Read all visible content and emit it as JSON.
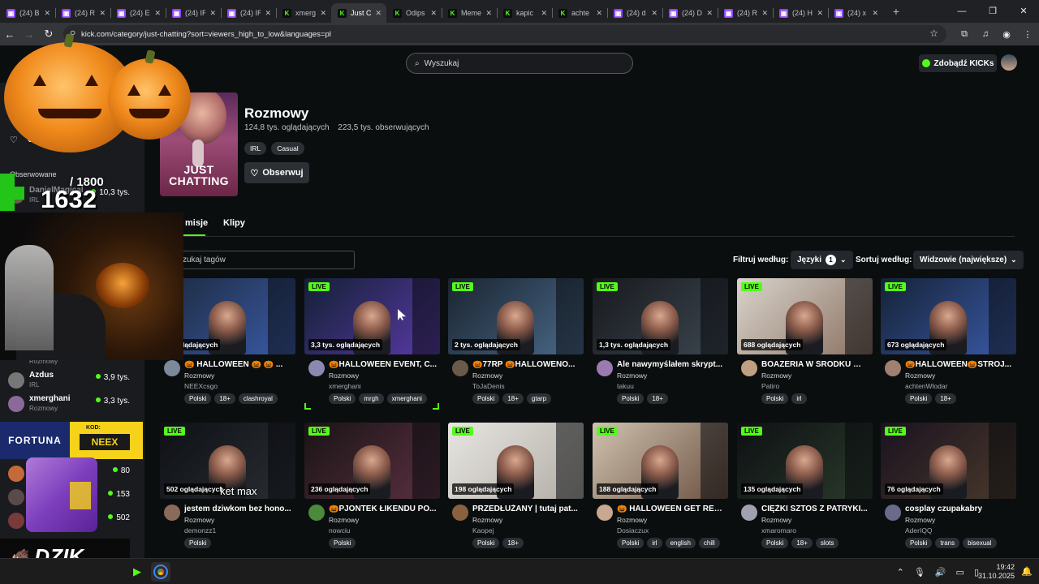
{
  "browser": {
    "tabs": [
      {
        "label": "(24) B",
        "icon": "twitch"
      },
      {
        "label": "(24) R",
        "icon": "twitch"
      },
      {
        "label": "(24) E",
        "icon": "twitch"
      },
      {
        "label": "(24) IR",
        "icon": "twitch"
      },
      {
        "label": "(24) IR",
        "icon": "twitch"
      },
      {
        "label": "xmerg",
        "icon": "kick"
      },
      {
        "label": "Just C",
        "icon": "kick",
        "active": true
      },
      {
        "label": "Odips",
        "icon": "kick"
      },
      {
        "label": "Meme",
        "icon": "kick"
      },
      {
        "label": "kapic",
        "icon": "kick"
      },
      {
        "label": "achte",
        "icon": "kick"
      },
      {
        "label": "(24) d",
        "icon": "twitch"
      },
      {
        "label": "(24) D",
        "icon": "twitch"
      },
      {
        "label": "(24) R",
        "icon": "twitch"
      },
      {
        "label": "(24) H",
        "icon": "twitch"
      },
      {
        "label": "(24) x",
        "icon": "twitch"
      }
    ],
    "url": "kick.com/category/just-chatting?sort=viewers_high_to_low&languages=pl"
  },
  "header": {
    "search_placeholder": "Wyszukaj",
    "get_kicks_label": "Zdobądź KICKs"
  },
  "sidebar": {
    "following_label": "Obserwowane",
    "heart_label": "Ob",
    "items": [
      {
        "name": "DanielMagical",
        "category": "IRL",
        "viewers": "10,3 tys."
      },
      {
        "name": "Azdus",
        "category": "IRL",
        "viewers": "3,9 tys."
      },
      {
        "name": "xmerghani",
        "category": "Rozmowy",
        "viewers": "3,3 tys."
      },
      {
        "name": "",
        "category": "",
        "viewers": "80"
      },
      {
        "name": "",
        "category": "",
        "viewers": "153"
      },
      {
        "name": "",
        "category": "",
        "viewers": "502"
      }
    ],
    "partial_category": "Rozmowy"
  },
  "category": {
    "thumb_text": "JUST CHATTING",
    "title": "Rozmowy",
    "viewers": "124,8 tys. oglądających",
    "followers": "223,5 tys. obserwujących",
    "tags": [
      "IRL",
      "Casual"
    ],
    "follow_label": "Obserwuj",
    "tab_streams": "misje",
    "tab_clips": "Klipy"
  },
  "filters": {
    "tag_search_placeholder": "zukaj tagów",
    "filter_label": "Filtruj według:",
    "languages_label": "Języki",
    "languages_count": "1",
    "sort_label": "Sortuj według:",
    "sort_value": "Widzowie (największe)"
  },
  "live_badge": "LIVE",
  "streams": [
    {
      "viewers": "s. oglądających",
      "title": "🎃 HALLOWEEN 🎃 🎃 ...",
      "category": "Rozmowy",
      "user": "NEEXcsgo",
      "tags": [
        "Polski",
        "18+",
        "clashroyal"
      ],
      "live": false
    },
    {
      "viewers": "3,3 tys. oglądających",
      "title": "🎃HALLOWEEN EVENT, C...",
      "category": "Rozmowy",
      "user": "xmerghani",
      "tags": [
        "Polski",
        "mrgh",
        "xmerghani"
      ],
      "live": true
    },
    {
      "viewers": "2 tys. oglądających",
      "title": "🎃77RP 🎃HALLOWENO...",
      "category": "Rozmowy",
      "user": "ToJaDenis",
      "tags": [
        "Polski",
        "18+",
        "gtarp"
      ],
      "live": true
    },
    {
      "viewers": "1,3 tys. oglądających",
      "title": "Ale nawymyślałem skrypt...",
      "category": "Rozmowy",
      "user": "takuu",
      "tags": [
        "Polski",
        "18+"
      ],
      "live": true
    },
    {
      "viewers": "688 oglądających",
      "title": "BOAZERIA W ŚRODKU 🟥 ...",
      "category": "Rozmowy",
      "user": "Patiro",
      "tags": [
        "Polski",
        "irl"
      ],
      "live": true
    },
    {
      "viewers": "673 oglądających",
      "title": "🎃HALLOWEEN🎃STROJ...",
      "category": "Rozmowy",
      "user": "achtenWlodar",
      "tags": [
        "Polski",
        "18+"
      ],
      "live": true
    },
    {
      "viewers": "502 oglądających",
      "title": "jestem dziwkom bez hono...",
      "category": "Rozmowy",
      "user": "demonzz1",
      "tags": [
        "Polski"
      ],
      "live": true
    },
    {
      "viewers": "236 oglądających",
      "title": "🎃PJONTEK ŁIKENDU PO...",
      "category": "Rozmowy",
      "user": "nowciu",
      "tags": [
        "Polski"
      ],
      "live": true
    },
    {
      "viewers": "198 oglądających",
      "title": "PRZEDŁUŻANY | tutaj pat...",
      "category": "Rozmowy",
      "user": "Kaopej",
      "tags": [
        "Polski",
        "18+"
      ],
      "live": true
    },
    {
      "viewers": "188 oglądających",
      "title": "🎃 HALLOWEEN GET REA...",
      "category": "Rozmowy",
      "user": "Dosiaczux",
      "tags": [
        "Polski",
        "irl",
        "english",
        "chill"
      ],
      "live": true
    },
    {
      "viewers": "135 oglądających",
      "title": "CIĘŻKI SZTOS Z PATRYKI...",
      "category": "Rozmowy",
      "user": "xmaromaro",
      "tags": [
        "Polski",
        "18+",
        "slots"
      ],
      "live": true
    },
    {
      "viewers": "76 oglądających",
      "title": "cosplay czupakabry",
      "category": "Rozmowy",
      "user": "AderIQQ",
      "tags": [
        "Polski",
        "trans",
        "bisexual"
      ],
      "live": true
    }
  ],
  "overlay": {
    "goal_counter": "/ 1800",
    "goal_current": "1632",
    "sponsor_brand": "FORTUNA",
    "sponsor_code_label": "KOD:",
    "sponsor_code": "NEEX",
    "brand_logo_text": "DZIK",
    "caption_text": "ket max"
  },
  "taskbar": {
    "time": "19:42",
    "date": "31.10.2025"
  }
}
